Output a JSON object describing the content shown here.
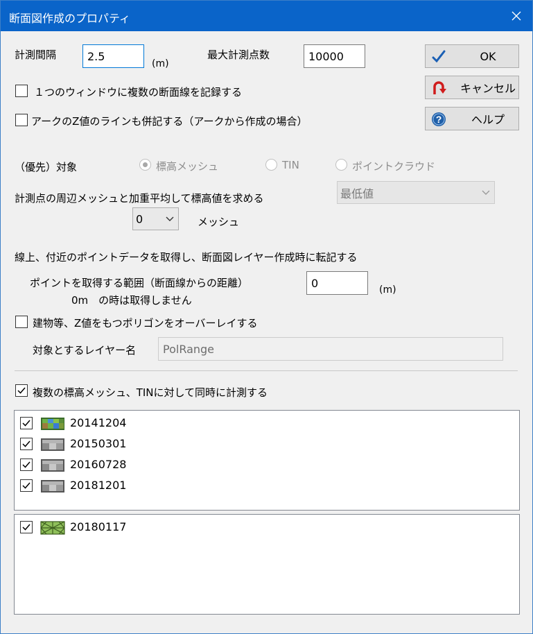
{
  "window": {
    "title": "断面図作成のプロパティ"
  },
  "measure": {
    "interval_label": "計測間隔",
    "interval_value": "2.5",
    "interval_unit": "(m)",
    "max_points_label": "最大計測点数",
    "max_points_value": "10000"
  },
  "buttons": {
    "ok": "OK",
    "cancel": "キャンセル",
    "help": "ヘルプ"
  },
  "options": {
    "multi_lines": "１つのウィンドウに複数の断面線を記録する",
    "arc_z": "アークのZ値のラインも併記する（アークから作成の場合）"
  },
  "priority": {
    "label": "（優先）対象",
    "options": [
      "標高メッシュ",
      "TIN",
      "ポイントクラウド"
    ],
    "selected": "標高メッシュ"
  },
  "weighted": {
    "label": "計測点の周辺メッシュと加重平均して標高値を求める",
    "method_value": "最低値",
    "mesh_count_value": "0",
    "mesh_unit": "メッシュ"
  },
  "points": {
    "section_label": "線上、付近のポイントデータを取得し、断面図レイヤー作成時に転記する",
    "range_label": "ポイントを取得する範囲（断面線からの距離）",
    "range_note": "0m　の時は取得しません",
    "range_value": "0",
    "range_unit": "(m)"
  },
  "polygon": {
    "overlay_label": "建物等、Z値をもつポリゴンをオーバーレイする",
    "layer_label": "対象とするレイヤー名",
    "layer_value": "PolRange"
  },
  "multi_measure": {
    "label": "複数の標高メッシュ、TINに対して同時に計測する",
    "checked": true
  },
  "mesh_list": [
    {
      "name": "20141204",
      "checked": true,
      "icon": "terrain-mesh-color-icon"
    },
    {
      "name": "20150301",
      "checked": true,
      "icon": "terrain-mesh-gray-icon"
    },
    {
      "name": "20160728",
      "checked": true,
      "icon": "terrain-mesh-gray-icon"
    },
    {
      "name": "20181201",
      "checked": true,
      "icon": "terrain-mesh-gray-icon"
    }
  ],
  "tin_list": [
    {
      "name": "20180117",
      "checked": true,
      "icon": "tin-icon"
    }
  ],
  "colors": {
    "titlebar": "#0a64c9",
    "accent": "#0078d7"
  }
}
